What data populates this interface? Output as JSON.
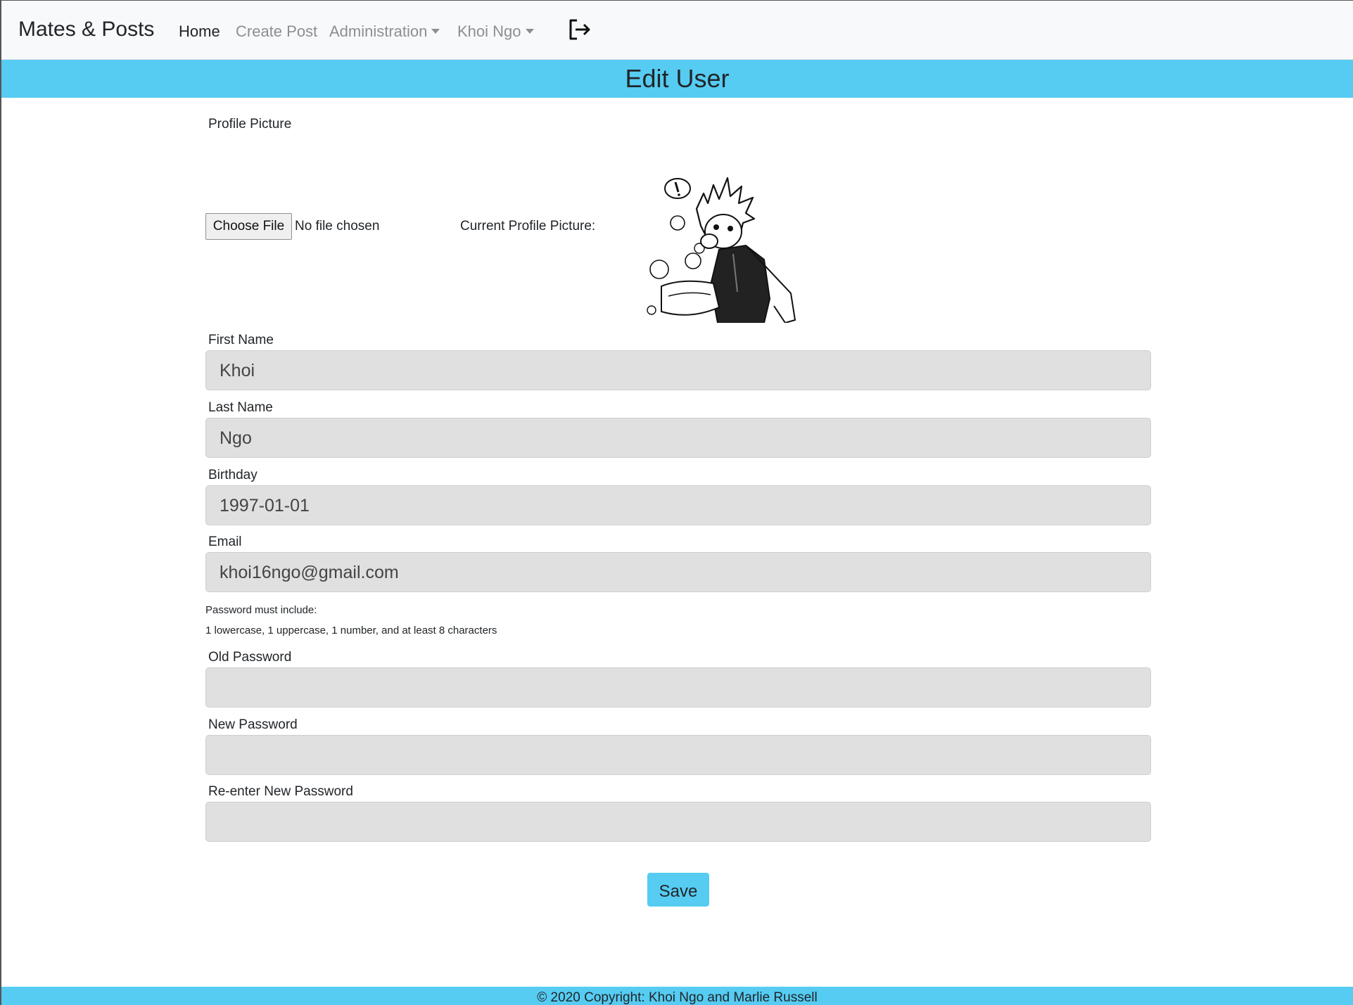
{
  "navbar": {
    "brand": "Mates & Posts",
    "links": [
      "Home",
      "Create Post",
      "Administration",
      "Khoi Ngo"
    ]
  },
  "page": {
    "title": "Edit User"
  },
  "form": {
    "profile_picture_label": "Profile Picture",
    "choose_file_label": "Choose File",
    "file_status": "No file chosen",
    "current_picture_label": "Current Profile Picture:",
    "first_name_label": "First Name",
    "first_name_value": "Khoi",
    "last_name_label": "Last Name",
    "last_name_value": "Ngo",
    "birthday_label": "Birthday",
    "birthday_value": "1997-01-01",
    "email_label": "Email",
    "email_value": "khoi16ngo@gmail.com",
    "password_hint_title": "Password must include:",
    "password_hint_rules": "1 lowercase, 1 uppercase, 1 number, and at least 8 characters",
    "old_password_label": "Old Password",
    "new_password_label": "New Password",
    "reenter_password_label": "Re-enter New Password",
    "save_label": "Save"
  },
  "footer": {
    "text": "© 2020 Copyright: Khoi Ngo and Marlie Russell"
  },
  "colors": {
    "accent": "#56ccf2",
    "navbar_bg": "#f8f9fa",
    "input_bg": "#e0e0e0"
  },
  "icons": {
    "logout": "logout-icon",
    "dropdown": "chevron-down-icon"
  }
}
